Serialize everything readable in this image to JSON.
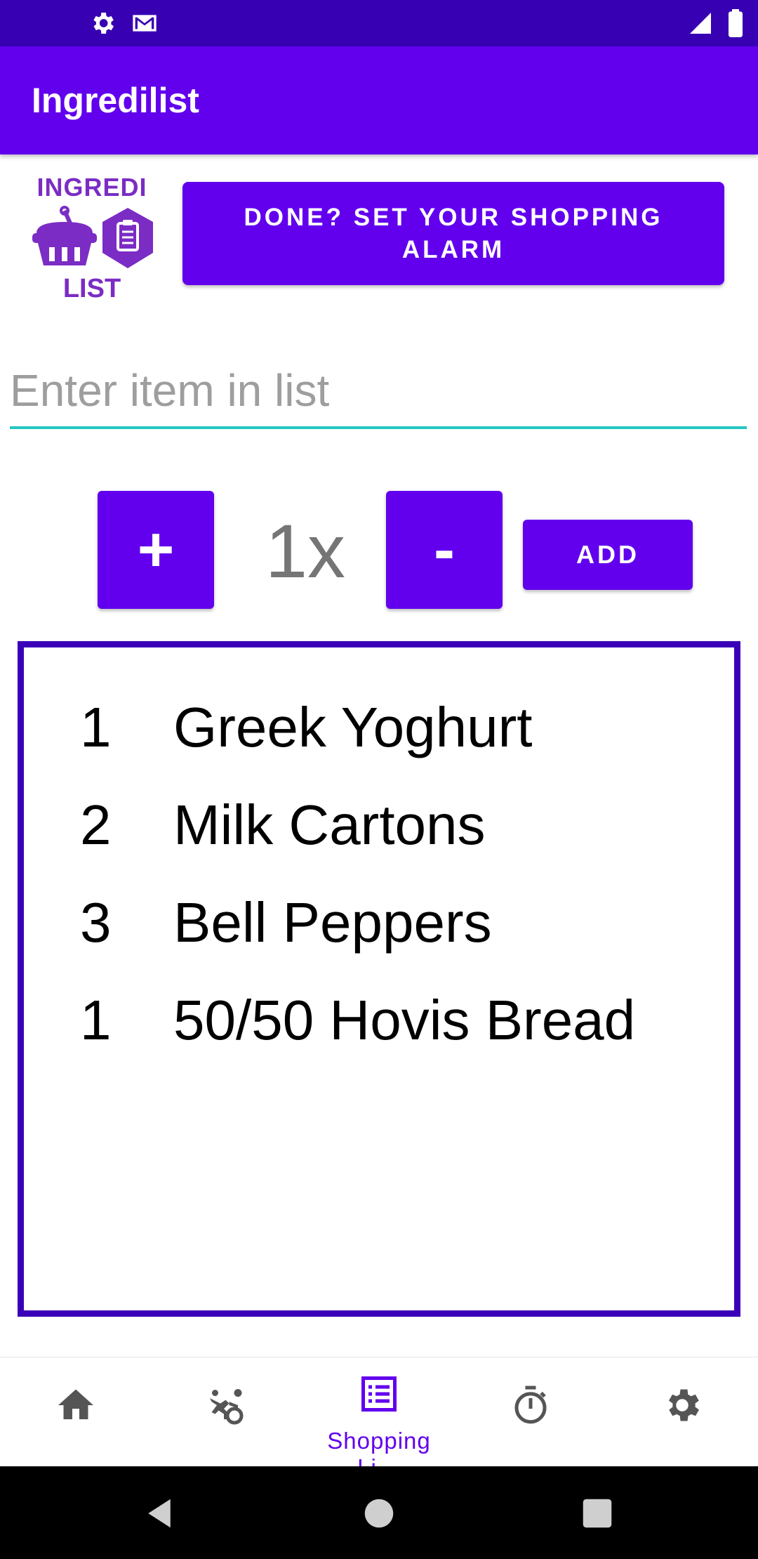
{
  "status_bar": {
    "left_icons": [
      "gear-icon",
      "gmail-icon"
    ],
    "right_icons": [
      "signal-icon",
      "battery-icon"
    ]
  },
  "app_bar": {
    "title": "Ingredilist"
  },
  "logo": {
    "top_text": "INGREDI",
    "bottom_text": "LIST"
  },
  "alarm_button": {
    "label": "DONE? SET YOUR SHOPPING ALARM"
  },
  "item_input": {
    "placeholder": "Enter item in list",
    "value": ""
  },
  "quantity": {
    "plus_label": "+",
    "minus_label": "-",
    "value": "1x",
    "add_label": "ADD"
  },
  "shopping_list": {
    "items": [
      {
        "qty": "1",
        "name": "Greek Yoghurt"
      },
      {
        "qty": "2",
        "name": "Milk Cartons"
      },
      {
        "qty": "3",
        "name": "Bell Peppers"
      },
      {
        "qty": "1",
        "name": "50/50 Hovis Bread"
      }
    ]
  },
  "bottom_nav": {
    "items": [
      {
        "icon": "home-icon",
        "label": ""
      },
      {
        "icon": "accessibility-icon",
        "label": ""
      },
      {
        "icon": "list-icon",
        "label": "Shopping Li…",
        "active": true
      },
      {
        "icon": "timer-icon",
        "label": ""
      },
      {
        "icon": "settings-icon",
        "label": ""
      }
    ]
  },
  "colors": {
    "primary": "#6200ee",
    "primary_dark": "#3700b3",
    "list_border": "#3a00b8",
    "input_underline": "#26c6c4",
    "nav_inactive": "#555555"
  }
}
